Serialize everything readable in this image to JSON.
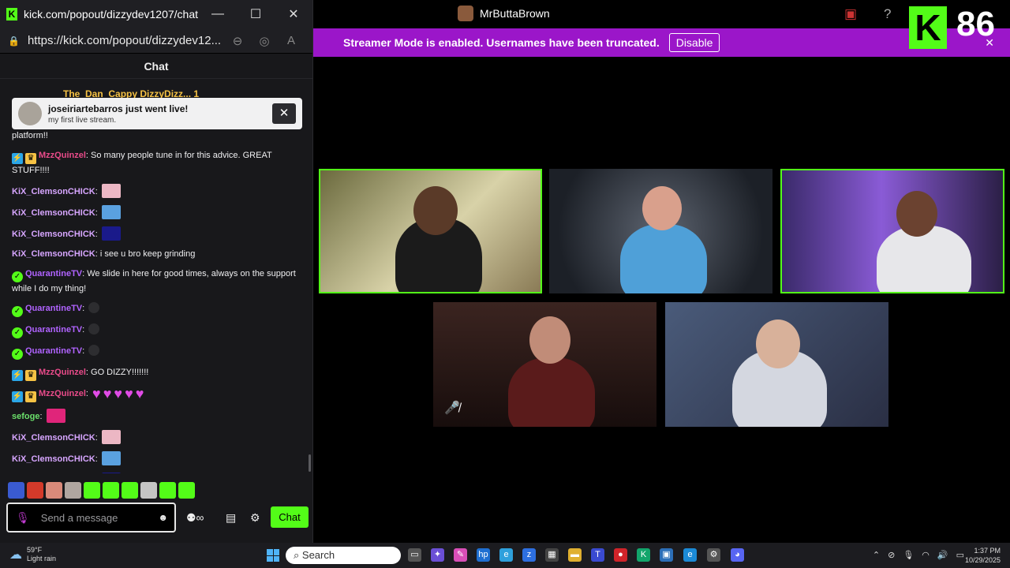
{
  "browser": {
    "tab_title": "kick.com/popout/dizzydev1207/chat -...",
    "url": "https://kick.com/popout/dizzydev12...",
    "controls": {
      "minimize": "—",
      "maximize": "☐",
      "close": "✕"
    }
  },
  "chat": {
    "header": "Chat",
    "pinned_partial": "The_Dan_Cappy   DizzyDizz... 1",
    "toast": {
      "title": "joseiriartebarros just went live!",
      "subtitle": "my first live stream."
    },
    "messages": [
      {
        "user": "",
        "text": "platform!!"
      },
      {
        "user": "MzzQuinzel",
        "color": "#e94b8a",
        "badges": [
          "blue",
          "crown"
        ],
        "text": "So many people tune in for this advice. GREAT STUFF!!!!"
      },
      {
        "user": "KiX_ClemsonCHICK",
        "color": "#d7a6ff",
        "emote": "good"
      },
      {
        "user": "KiX_ClemsonCHICK",
        "color": "#d7a6ff",
        "emote": "cool"
      },
      {
        "user": "KiX_ClemsonCHICK",
        "color": "#d7a6ff",
        "emote": "blue"
      },
      {
        "user": "KiX_ClemsonCHICK",
        "color": "#d7a6ff",
        "text": "i see u bro keep grinding"
      },
      {
        "user": "QuarantineTV",
        "color": "#b063ff",
        "badges": [
          "verified"
        ],
        "text": "We slide in here for good times, always on the support while I do my thing!"
      },
      {
        "user": "QuarantineTV",
        "color": "#b063ff",
        "badges": [
          "verified"
        ],
        "emote": "small"
      },
      {
        "user": "QuarantineTV",
        "color": "#b063ff",
        "badges": [
          "verified"
        ],
        "emote": "small"
      },
      {
        "user": "QuarantineTV",
        "color": "#b063ff",
        "badges": [
          "verified"
        ],
        "emote": "small"
      },
      {
        "user": "MzzQuinzel",
        "color": "#e94b8a",
        "badges": [
          "blue",
          "crown"
        ],
        "text": "GO DIZZY!!!!!!!"
      },
      {
        "user": "MzzQuinzel",
        "color": "#e94b8a",
        "badges": [
          "blue",
          "crown"
        ],
        "emote": "hearts"
      },
      {
        "user": "sefoge",
        "color": "#6be06b",
        "emote": "gem"
      },
      {
        "user": "KiX_ClemsonCHICK",
        "color": "#d7a6ff",
        "emote": "good"
      },
      {
        "user": "KiX_ClemsonCHICK",
        "color": "#d7a6ff",
        "emote": "cool"
      },
      {
        "user": "KiX_ClemsonCHICK",
        "color": "#d7a6ff",
        "emote": "blue"
      }
    ],
    "emote_bar": [
      "#3a5bd1",
      "#d33a2a",
      "#d98a7a",
      "#b0a6a0",
      "#53fc18",
      "#53fc18",
      "#53fc18",
      "#c4c4c4",
      "#53fc18",
      "#53fc18"
    ],
    "composer": {
      "placeholder": "Send a message",
      "send_label": "Chat"
    }
  },
  "stream": {
    "streamer_name": "MrButtaBrown",
    "banner_text": "Streamer Mode is enabled. Usernames have been truncated.",
    "banner_button": "Disable",
    "kick_logo": "K",
    "viewer_count": "86",
    "accent": "#53fc18",
    "banner_color": "#9b16c9"
  },
  "taskbar": {
    "weather_temp": "59°F",
    "weather_desc": "Light rain",
    "search_label": "Search",
    "time": "1:37 PM",
    "date": "10/29/2025"
  }
}
